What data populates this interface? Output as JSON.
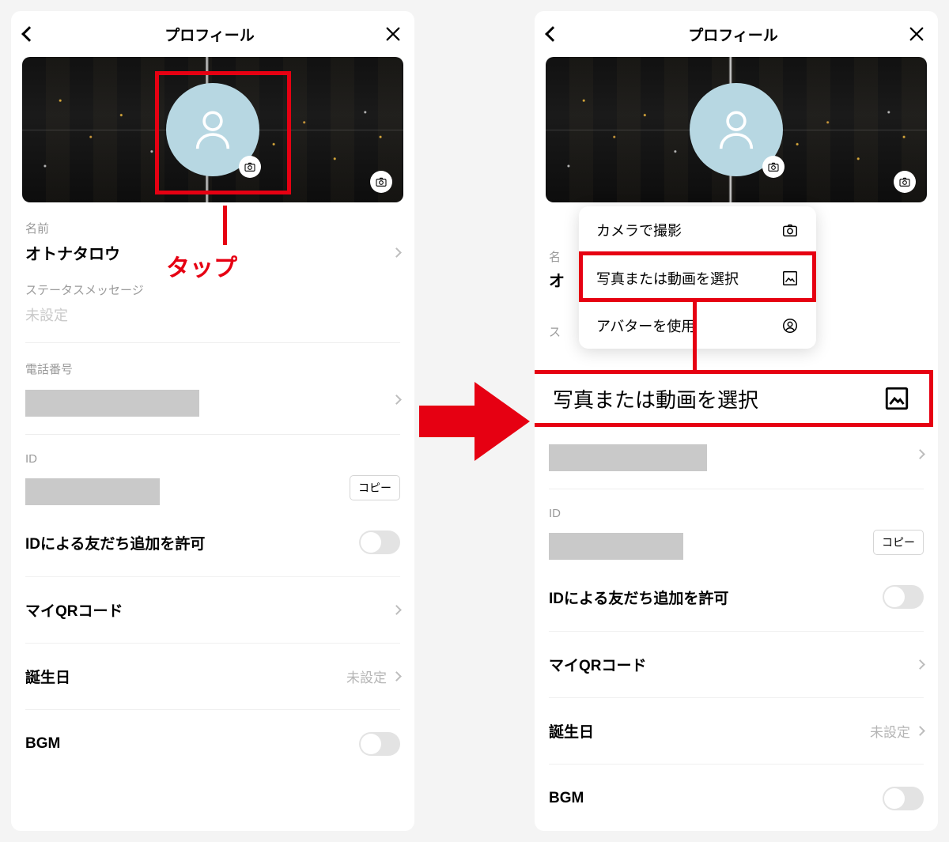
{
  "header": {
    "title": "プロフィール"
  },
  "profile": {
    "name_label": "名前",
    "name_value": "オトナタロウ",
    "status_label": "ステータスメッセージ",
    "status_value": "未設定",
    "phone_label": "電話番号",
    "id_label": "ID",
    "copy_button": "コピー",
    "allow_friend_by_id": "IDによる友だち追加を許可",
    "qr_label": "マイQRコード",
    "birthday_label": "誕生日",
    "birthday_value": "未設定",
    "bgm_label": "BGM"
  },
  "popup": {
    "camera": "カメラで撮影",
    "select_media": "写真または動画を選択",
    "use_avatar": "アバターを使用"
  },
  "callout": {
    "label": "写真または動画を選択"
  },
  "annotations": {
    "tap": "タップ"
  },
  "behind": {
    "name_initial": "名",
    "name_second": "オ",
    "status_frag": "ス"
  }
}
